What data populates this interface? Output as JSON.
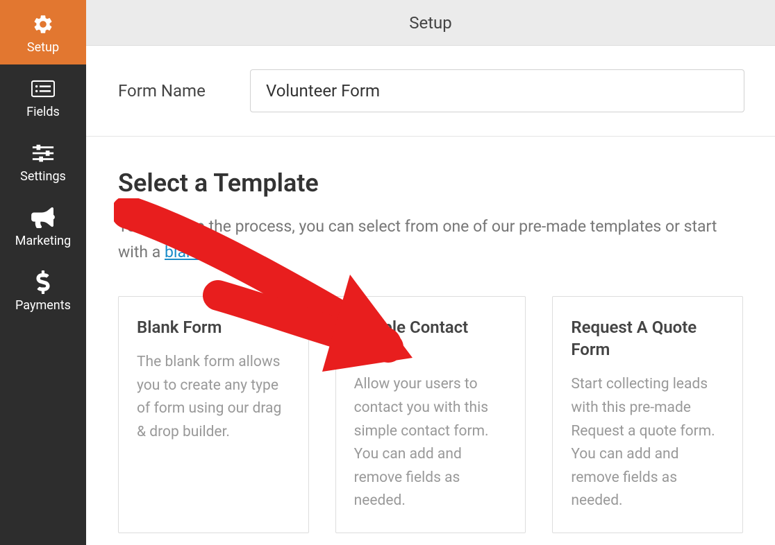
{
  "sidebar": {
    "items": [
      {
        "label": "Setup"
      },
      {
        "label": "Fields"
      },
      {
        "label": "Settings"
      },
      {
        "label": "Marketing"
      },
      {
        "label": "Payments"
      }
    ]
  },
  "topbar": {
    "title": "Setup"
  },
  "form_name": {
    "label": "Form Name",
    "value": "Volunteer Form"
  },
  "template_section": {
    "heading": "Select a Template",
    "intro_prefix": "To speed up the process, you can select from one of our pre-made templates or start with a ",
    "intro_link": "blank form."
  },
  "templates": [
    {
      "title": "Blank Form",
      "desc": "The blank form allows you to create any type of form using our drag & drop builder."
    },
    {
      "title": "Simple Contact Form",
      "desc": "Allow your users to contact you with this simple contact form. You can add and remove fields as needed."
    },
    {
      "title": "Request A Quote Form",
      "desc": "Start collecting leads with this pre-made Request a quote form. You can add and remove fields as needed."
    }
  ]
}
